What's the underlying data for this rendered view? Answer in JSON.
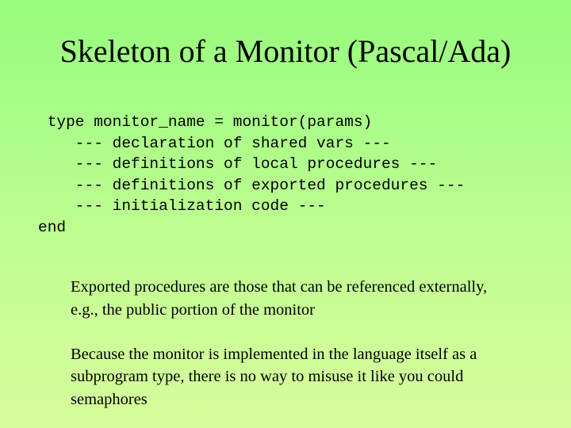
{
  "slide": {
    "title": "Skeleton of a Monitor (Pascal/Ada)",
    "background": {
      "gradient_top": "#97fc7c",
      "gradient_bottom": "#d6fd9d",
      "direction": "vertical"
    },
    "text_color": "#000000",
    "code_block": {
      "lines": [
        " type monitor_name = monitor(params)",
        "    --- declaration of shared vars ---",
        "    --- definitions of local procedures ---",
        "    --- definitions of exported procedures ---",
        "    --- initialization code ---",
        "end"
      ]
    },
    "paragraphs": [
      "Exported procedures are those that can be referenced externally, e.g., the public portion of the monitor",
      "Because the monitor is implemented in the language itself as a subprogram type, there is no way to misuse it like you could semaphores"
    ]
  }
}
